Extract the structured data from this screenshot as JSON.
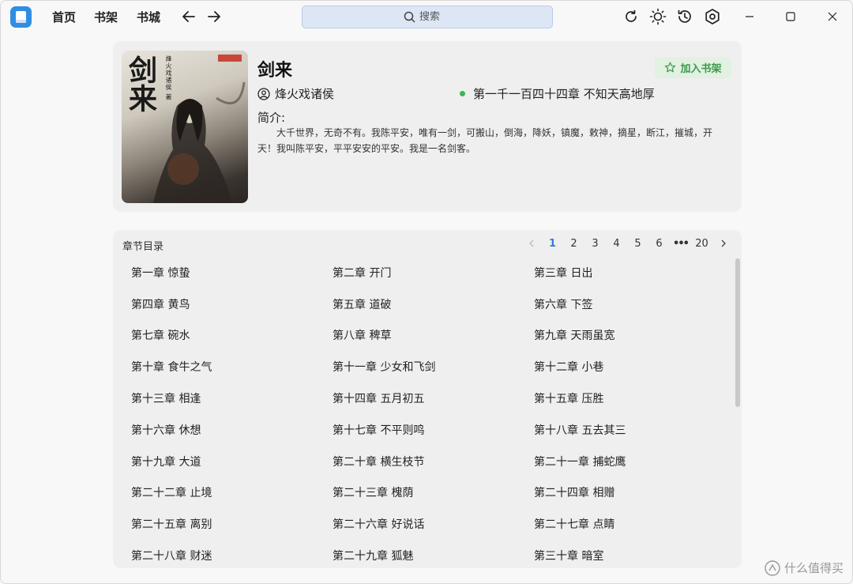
{
  "nav": {
    "home": "首页",
    "shelf": "书架",
    "store": "书城"
  },
  "search": {
    "placeholder": "搜索"
  },
  "book": {
    "title": "剑来",
    "author": "烽火戏诸侯",
    "latest_chapter": "第一千一百四十四章 不知天高地厚",
    "add_to_shelf": "加入书架",
    "intro_label": "简介:",
    "intro": "大千世界，无奇不有。我陈平安，唯有一剑，可搬山，倒海，降妖，镇魔，敕神，摘星，断江，摧城，开天！我叫陈平安，平平安安的平安。我是一名剑客。",
    "cover_title": "剑来",
    "cover_author": "烽火戏诸侯 著"
  },
  "chapters": {
    "title": "章节目录",
    "pages": [
      "1",
      "2",
      "3",
      "4",
      "5",
      "6",
      "•••",
      "20"
    ],
    "current_page": "1",
    "items": [
      "第一章 惊蛰",
      "第二章 开门",
      "第三章 日出",
      "第四章 黄鸟",
      "第五章 道破",
      "第六章 下签",
      "第七章 碗水",
      "第八章 稗草",
      "第九章 天雨虽宽",
      "第十章 食牛之气",
      "第十一章 少女和飞剑",
      "第十二章 小巷",
      "第十三章 相逢",
      "第十四章 五月初五",
      "第十五章 压胜",
      "第十六章 休想",
      "第十七章 不平则鸣",
      "第十八章 五去其三",
      "第十九章 大道",
      "第二十章 横生枝节",
      "第二十一章 捕蛇鹰",
      "第二十二章 止境",
      "第二十三章 槐荫",
      "第二十四章 相赠",
      "第二十五章 离别",
      "第二十六章 好说话",
      "第二十七章 点睛",
      "第二十八章 财迷",
      "第二十九章 狐魅",
      "第三十章 暗室"
    ]
  },
  "watermark": "什么值得买",
  "colors": {
    "accent": "#2f7fd8",
    "shelf_green": "#3b9a4a",
    "status_dot": "#3db554"
  }
}
